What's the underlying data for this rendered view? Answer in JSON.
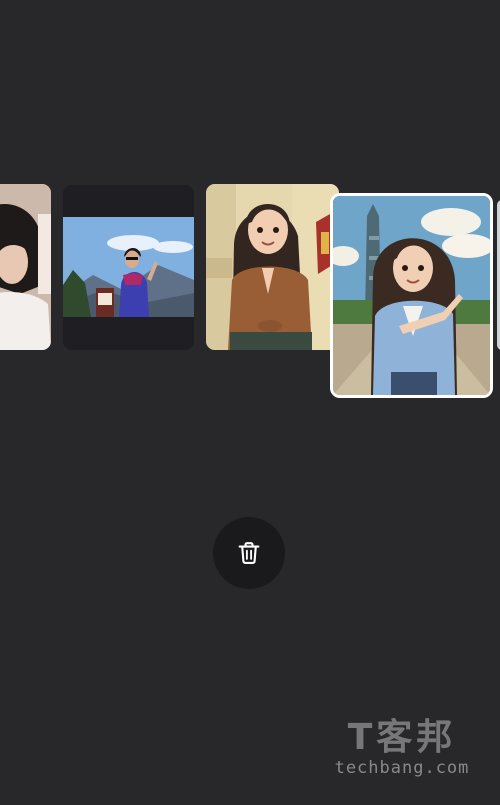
{
  "gallery": {
    "items": [
      {
        "name": "photo-1",
        "description": "partial photo of a woman",
        "selected": false
      },
      {
        "name": "photo-2",
        "description": "woman posing outdoors with mountains",
        "selected": false
      },
      {
        "name": "photo-3",
        "description": "cartoon-style portrait, brown shirt",
        "selected": false
      },
      {
        "name": "photo-4",
        "description": "cartoon-style portrait near tower, blue shirt",
        "selected": true
      },
      {
        "name": "photo-5",
        "description": "partially visible next item",
        "selected": false
      }
    ]
  },
  "actions": {
    "delete_icon": "trash-icon"
  },
  "watermark": {
    "logo": "T客邦",
    "domain": "techbang.com"
  },
  "colors": {
    "background": "#28282b",
    "button_bg": "#1a1a1d",
    "selection_border": "#ffffff"
  }
}
